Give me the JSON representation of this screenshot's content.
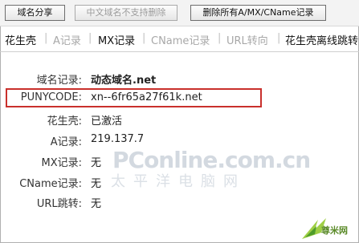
{
  "toolbar": {
    "buttons": [
      {
        "label": "域名分享",
        "disabled": false
      },
      {
        "label": "中文域名不支持删除",
        "disabled": true
      },
      {
        "label": "删除所有A/MX/CName记录",
        "disabled": false
      }
    ]
  },
  "tabs": [
    {
      "label": "花生壳",
      "active": true
    },
    {
      "label": "A记录",
      "active": false
    },
    {
      "label": "MX记录",
      "active": false
    },
    {
      "label": "CName记录",
      "active": false
    },
    {
      "label": "URL转向",
      "active": false
    },
    {
      "label": "花生壳离线跳转",
      "active": false
    }
  ],
  "fields": [
    {
      "label": "域名记录:",
      "value": "动态域名.net"
    },
    {
      "label": "PUNYCODE:",
      "value": "xn--6fr65a27f61k.net"
    },
    {
      "label": "花生壳:",
      "value": "已激活"
    },
    {
      "label": "A记录:",
      "value": "219.137.7"
    },
    {
      "label": "MX记录:",
      "value": "无"
    },
    {
      "label": "CName记录:",
      "value": "无"
    },
    {
      "label": "URL跳转:",
      "value": "无"
    }
  ],
  "watermark": {
    "line1": "PConline.com.cn",
    "line2": "太平洋电脑网"
  },
  "corner_logo": {
    "text": "尊米网"
  },
  "colors": {
    "highlight": "#c9302c",
    "toolbar_bg": "#f3f3f3",
    "disabled_text": "#9a9a9a"
  }
}
